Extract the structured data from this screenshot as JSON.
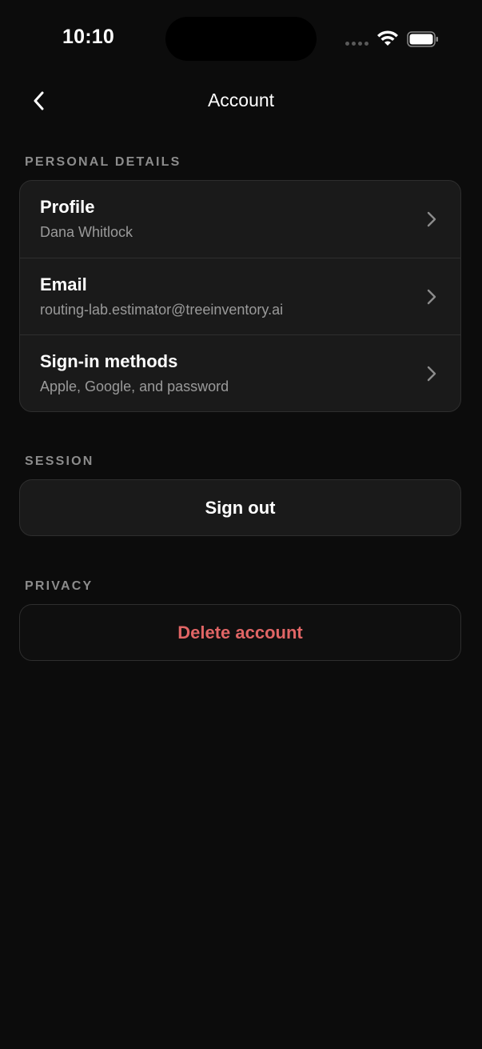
{
  "status_bar": {
    "time": "10:10"
  },
  "nav": {
    "title": "Account"
  },
  "sections": {
    "personal": {
      "header": "PERSONAL DETAILS",
      "rows": [
        {
          "title": "Profile",
          "subtitle": "Dana Whitlock"
        },
        {
          "title": "Email",
          "subtitle": "routing-lab.estimator@treeinventory.ai"
        },
        {
          "title": "Sign-in methods",
          "subtitle": "Apple, Google, and password"
        }
      ]
    },
    "session": {
      "header": "SESSION",
      "button_label": "Sign out"
    },
    "privacy": {
      "header": "PRIVACY",
      "button_label": "Delete account"
    }
  },
  "colors": {
    "background": "#0c0c0c",
    "card": "#1a1a1a",
    "destructive": "#e06565",
    "secondary_text": "#9a9a9a"
  }
}
